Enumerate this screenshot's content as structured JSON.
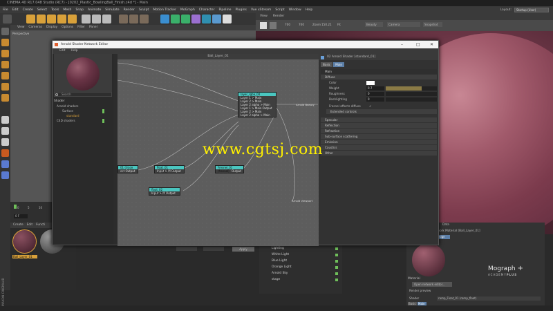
{
  "app": {
    "title": "CINEMA 4D R17.048 Studio (RC7) - [0202_Plastic_BowlingBall_Finish.c4d *] - Main",
    "menu": [
      "File",
      "Edit",
      "Create",
      "Select",
      "Tools",
      "Mesh",
      "Snap",
      "Animate",
      "Simulate",
      "Render",
      "Sculpt",
      "Motion Tracker",
      "MoGraph",
      "Character",
      "Pipeline",
      "Plugins",
      "Vue xStream",
      "Script",
      "Window",
      "Help"
    ],
    "layout_label": "Layout:",
    "layout_value": "Startup (User)"
  },
  "viewport": {
    "menu": [
      "View",
      "Cameras",
      "Display",
      "Options",
      "Filter",
      "Panel"
    ],
    "label": "Perspective"
  },
  "render": {
    "menu": [
      "View",
      "Render"
    ],
    "zoom_label": "Zoom",
    "zoom_value": "150.21",
    "dims": [
      "700",
      "700"
    ],
    "fit": "Fit",
    "channel": "Beauty",
    "camera": "Camera",
    "snapshot": "Snapshot"
  },
  "timeline": {
    "ticks": [
      "0",
      "5",
      "10"
    ],
    "frame": "0 F"
  },
  "materials": {
    "menu": [
      "Create",
      "Edit",
      "Functi"
    ],
    "items": [
      "Ball_Layer_01"
    ]
  },
  "objects": {
    "rows": [
      "Lighting",
      "White Light",
      "Blue Light",
      "Orange Light",
      "Arnold Sky",
      "stage"
    ]
  },
  "attributes": {
    "header": "Data",
    "note": "twork Material [Ball_Layer_01]",
    "design": "esign",
    "material_label": "Material",
    "open_btn": "Open network editor...",
    "render_preview": "Render preview",
    "shader_label": "Shader",
    "shader_value": "ramp_Float_01 (ramp_float)",
    "tabs": [
      "Basic",
      "Main"
    ]
  },
  "apply_button": "Apply",
  "dialog": {
    "title": "Arnold Shader Network Editor",
    "menu": [
      "Edit",
      "Help"
    ],
    "search": "Search",
    "tree": {
      "head": "Shader",
      "items": [
        "Arnold shaders",
        "Surface",
        "standard",
        "C4D shaders"
      ]
    },
    "graph_title": "Ball_Layer_01",
    "nodes": [
      {
        "title": "layer_rgba_04 (layer_rgba)",
        "rows": [
          "Layer 1 > Main",
          "Layer 2 > Main",
          "Layer 2 alpha > Main",
          "Layer 1 > Main   Output",
          "Layer 2 > Main",
          "Layer 2 alpha > Main"
        ]
      },
      {
        "title": "float_01 (ramp_float)",
        "rows": [
          "Input > M Output"
        ]
      },
      {
        "title": "float_02 (ramp_float)",
        "rows": [
          "Input > M Output"
        ]
      },
      {
        "title": "Fresnel_01 (fresnel)",
        "rows": [
          "Output"
        ]
      },
      {
        "title": "01 (trace set)",
        "rows": [
          "ect  Output"
        ]
      }
    ],
    "graph_labels": [
      "Arnold Beauty",
      "Arnold Viewport"
    ],
    "props": {
      "header": "02 Arnold Shader [standard_01]",
      "tabs": [
        "Basic",
        "Main"
      ],
      "main": "Main",
      "diffuse": "Diffuse",
      "rows": [
        {
          "label": "Color"
        },
        {
          "label": "Weight",
          "value": "0.7",
          "fill": 0.7
        },
        {
          "label": "Roughness",
          "value": "0"
        },
        {
          "label": "Backlighting",
          "value": "0"
        }
      ],
      "fresnel": "Fresnel affects diffuse",
      "extended": "Extended controls",
      "sections": [
        "Specular",
        "Reflection",
        "Refraction",
        "Sub-surface scattering",
        "Emission",
        "Caustics",
        "Other"
      ]
    }
  },
  "watermark": "www.cgtsj.com",
  "brand": {
    "mograph": "Mograph",
    "plus": "PLUS",
    "sub": "ACADEMY",
    "maxon": "MAXON CINEMA4D"
  }
}
